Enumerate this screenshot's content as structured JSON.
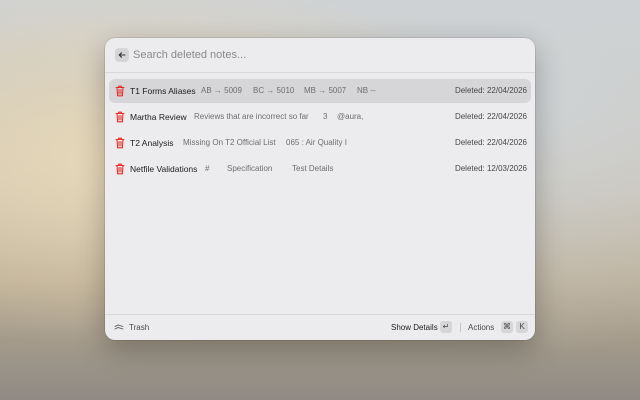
{
  "search": {
    "placeholder": "Search deleted notes...",
    "back_icon": "arrow-left-icon"
  },
  "notes": [
    {
      "title": "T1 Forms Aliases",
      "segments": [
        "AB → 5009",
        "BC → 5010",
        "MB → 5007",
        "NB --"
      ],
      "deleted": "Deleted: 22/04/2026",
      "selected": true
    },
    {
      "title": "Martha Review",
      "segments": [
        "Reviews that are incorrect so far",
        "3",
        "@aura,"
      ],
      "deleted": "Deleted: 22/04/2026",
      "selected": false
    },
    {
      "title": "T2 Analysis",
      "segments": [
        "Missing On T2 Official List",
        "065 : Air Quality I"
      ],
      "deleted": "Deleted: 22/04/2026",
      "selected": false
    },
    {
      "title": "Netfile Validations",
      "segments": [
        "#",
        "Specification",
        "Test Details"
      ],
      "deleted": "Deleted: 12/03/2026",
      "selected": false
    }
  ],
  "footer": {
    "label": "Trash",
    "show_details": "Show Details",
    "enter_key": "↵",
    "actions": "Actions",
    "cmd_key": "⌘",
    "k_key": "K"
  },
  "colors": {
    "trash_icon": "#e5312c",
    "selected_row": "#d6d6d9"
  }
}
